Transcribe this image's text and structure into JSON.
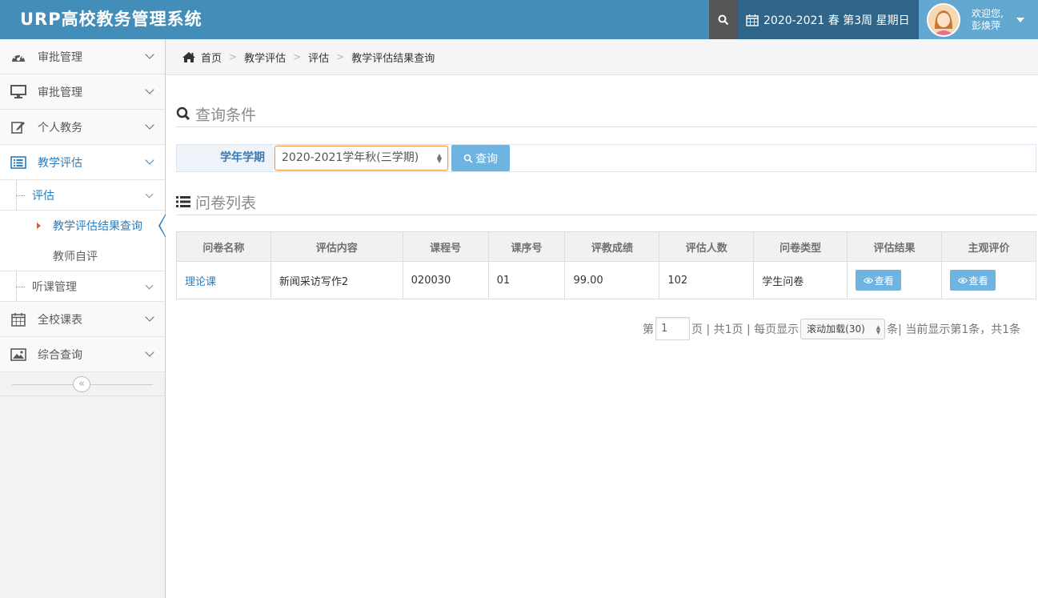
{
  "app": {
    "title": "URP高校教务管理系统"
  },
  "header": {
    "date_text": "2020-2021 春 第3周 星期日",
    "welcome": "欢迎您,",
    "user_name": "彭焕萍"
  },
  "sidebar": {
    "items": [
      {
        "label": "审批管理",
        "icon": "dashboard-icon"
      },
      {
        "label": "审批管理",
        "icon": "desktop-icon"
      },
      {
        "label": "个人教务",
        "icon": "edit-icon"
      },
      {
        "label": "教学评估",
        "icon": "list-alt-icon"
      }
    ],
    "sub": {
      "eval": "评估",
      "eval_result": "教学评估结果查询",
      "teacher_self": "教师自评",
      "lecture_mgmt": "听课管理"
    },
    "bottom_items": [
      {
        "label": "全校课表",
        "icon": "calendar-icon"
      },
      {
        "label": "综合查询",
        "icon": "picture-icon"
      }
    ],
    "collapse_symbol": "«"
  },
  "breadcrumb": {
    "home": "首页",
    "items": [
      "教学评估",
      "评估",
      "教学评估结果查询"
    ],
    "separator": ">"
  },
  "query": {
    "section_title": "查询条件",
    "label": "学年学期",
    "selected_term": "2020-2021学年秋(三学期)",
    "button_label": "查询"
  },
  "list": {
    "section_title": "问卷列表",
    "columns": [
      "问卷名称",
      "评估内容",
      "课程号",
      "课序号",
      "评教成绩",
      "评估人数",
      "问卷类型",
      "评估结果",
      "主观评价"
    ],
    "rows": [
      {
        "name": "理论课",
        "content": "新闻采访写作2",
        "course_no": "020030",
        "seq_no": "01",
        "score": "99.00",
        "count": "102",
        "type": "学生问卷",
        "result_btn": "查看",
        "comment_btn": "查看"
      }
    ]
  },
  "pager": {
    "prefix": "第",
    "page": "1",
    "total_pages": "页 | 共1页 | 每页显示",
    "page_size": "滚动加载(30)",
    "suffix": "条| 当前显示第1条，共1条"
  },
  "colors": {
    "header_bg": "#438eb9",
    "date_bg": "#2e6589",
    "user_bg": "#62a8d1",
    "accent": "#2b7dbc",
    "button": "#6fb3e0"
  }
}
